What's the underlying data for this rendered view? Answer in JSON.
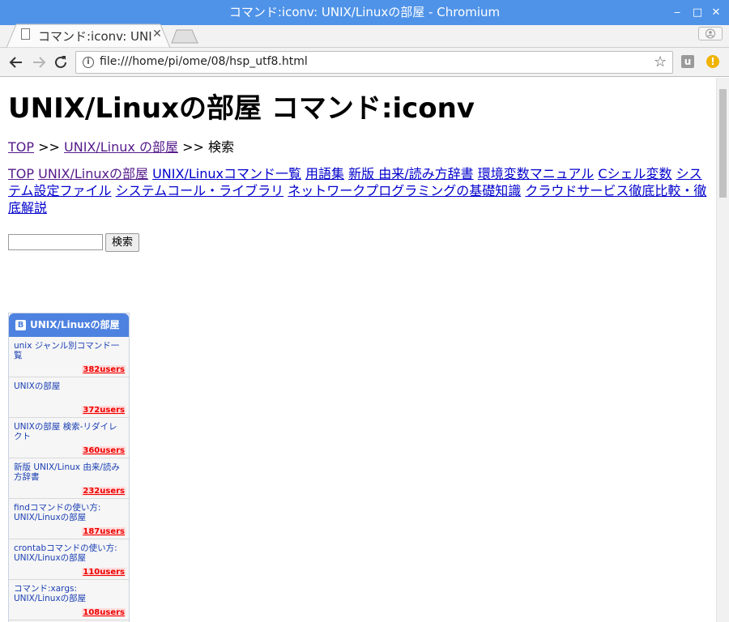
{
  "window": {
    "title": "コマンド:iconv: UNIX/Linuxの部屋 - Chromium"
  },
  "tab": {
    "title": "コマンド:iconv: UNIX/Linuxの部屋"
  },
  "address_bar": {
    "url": "file:///home/pi/ome/08/hsp_utf8.html"
  },
  "extensions": {
    "u_label": "u",
    "warn_label": "!"
  },
  "page": {
    "heading": "UNIX/Linuxの部屋 コマンド:iconv",
    "breadcrumb": {
      "top": "TOP",
      "sep1": ">>",
      "room": "UNIX/Linux の部屋",
      "sep2": ">>",
      "current": "検索"
    },
    "nav_links": [
      "TOP",
      "UNIX/Linuxの部屋",
      "UNIX/Linuxコマンド一覧",
      "用語集",
      "新版 由来/読み方辞書",
      "環境変数マニュアル",
      "Cシェル変数",
      "システム設定ファイル",
      "システムコール・ライブラリ",
      "ネットワークプログラミングの基礎知識",
      "クラウドサービス徹底比較・徹底解説"
    ],
    "search": {
      "button_label": "検索",
      "value": ""
    }
  },
  "hatena": {
    "logo": "B",
    "title": "UNIX/Linuxの部屋",
    "items": [
      {
        "title": "unix ジャンル別コマンド一覧",
        "users": "382users"
      },
      {
        "title": "UNIXの部屋",
        "users": "372users"
      },
      {
        "title": "UNIXの部屋 検索-リダイレクト",
        "users": "360users"
      },
      {
        "title": "新版 UNIX/Linux 由来/読み方辞書",
        "users": "232users"
      },
      {
        "title": "findコマンドの使い方: UNIX/Linuxの部屋",
        "users": "187users"
      },
      {
        "title": "crontabコマンドの使い方: UNIX/Linuxの部屋",
        "users": "110users"
      },
      {
        "title": "コマンド:xargs: UNIX/Linuxの部屋",
        "users": "108users"
      }
    ]
  },
  "colors": {
    "titlebar": "#4f93e8",
    "link": "#0000cc",
    "visited": "#551a8b",
    "hatena_blue": "#4e82e0",
    "users_red": "#ee0000"
  }
}
